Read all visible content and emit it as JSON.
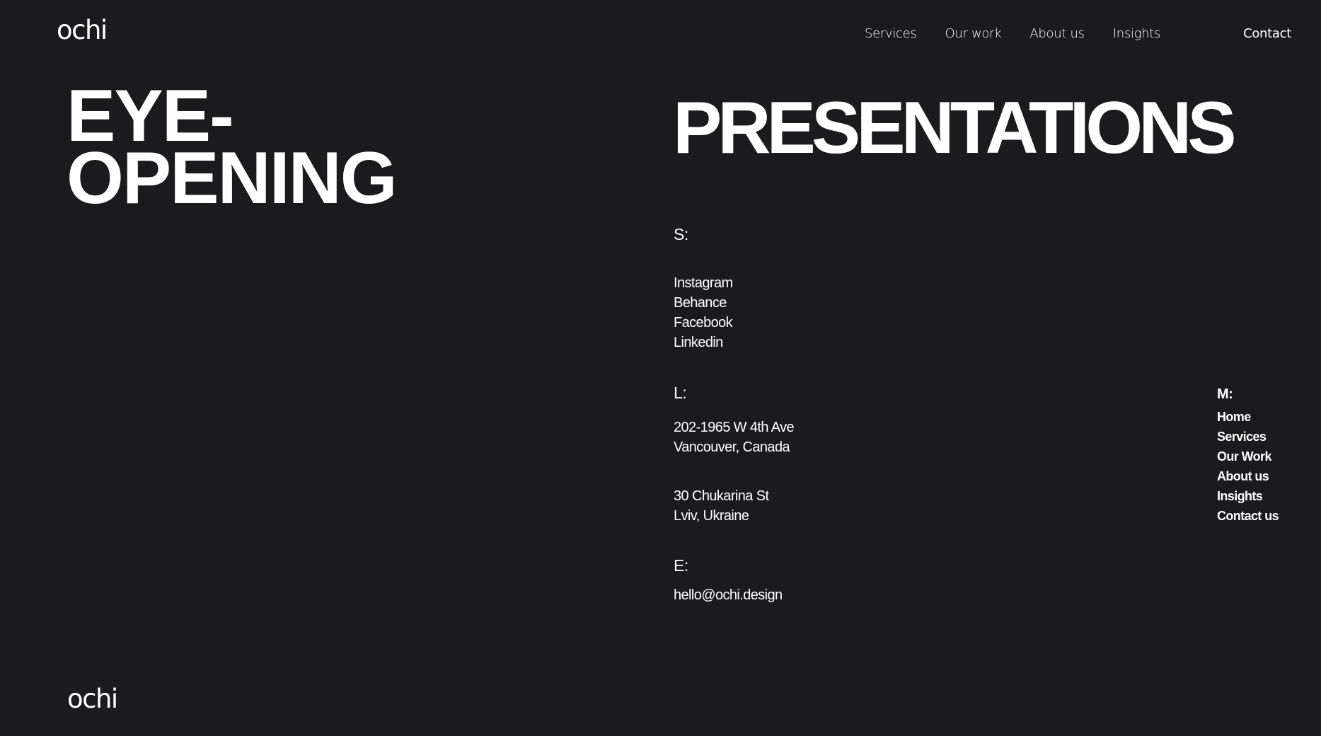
{
  "header": {
    "logo": "ochi",
    "nav": [
      {
        "label": "Services"
      },
      {
        "label": "Our work"
      },
      {
        "label": "About us"
      },
      {
        "label": "Insights"
      }
    ],
    "contact": "Contact"
  },
  "hero": {
    "left_line1": "EYE-",
    "left_line2": "OPENING",
    "right": "PRESENTATIONS"
  },
  "socials": {
    "label": "S:",
    "links": [
      "Instagram",
      "Behance",
      "Facebook",
      "Linkedin"
    ]
  },
  "locations": {
    "label": "L:",
    "addresses": [
      {
        "line1": "202-1965 W 4th Ave",
        "line2": "Vancouver, Canada"
      },
      {
        "line1": "30 Chukarina St",
        "line2": "Lviv, Ukraine"
      }
    ]
  },
  "email": {
    "label": "E:",
    "address": "hello@ochi.design"
  },
  "menu": {
    "label": "M:",
    "items": [
      "Home",
      "Services",
      "Our Work",
      "About us",
      "Insights",
      "Contact us"
    ]
  },
  "footer": {
    "logo": "ochi"
  },
  "colors": {
    "background": "#1b1b1e",
    "text": "#ffffff"
  }
}
